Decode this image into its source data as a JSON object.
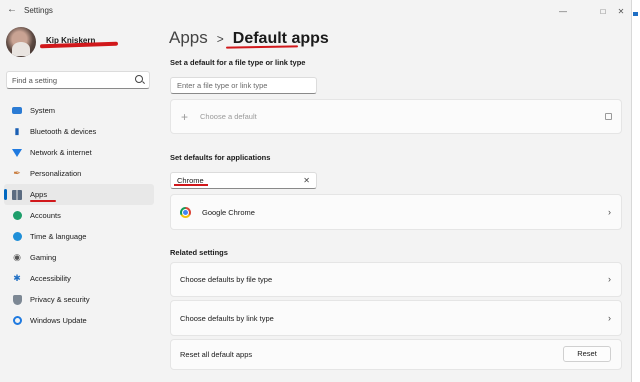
{
  "window": {
    "title": "Settings",
    "controls": [
      "minimize",
      "maximize",
      "close"
    ]
  },
  "profile": {
    "name": "Kip Kniskern"
  },
  "search": {
    "placeholder": "Find a setting"
  },
  "sidebar": {
    "items": [
      {
        "label": "System",
        "icon": "monitor-icon"
      },
      {
        "label": "Bluetooth & devices",
        "icon": "bluetooth-icon"
      },
      {
        "label": "Network & internet",
        "icon": "wifi-icon"
      },
      {
        "label": "Personalization",
        "icon": "brush-icon"
      },
      {
        "label": "Apps",
        "icon": "apps-icon",
        "active": true
      },
      {
        "label": "Accounts",
        "icon": "account-icon"
      },
      {
        "label": "Time & language",
        "icon": "globe-clock-icon"
      },
      {
        "label": "Gaming",
        "icon": "gamepad-icon"
      },
      {
        "label": "Accessibility",
        "icon": "accessibility-icon"
      },
      {
        "label": "Privacy & security",
        "icon": "shield-icon"
      },
      {
        "label": "Windows Update",
        "icon": "update-icon"
      }
    ]
  },
  "breadcrumb": {
    "parent": "Apps",
    "separator": ">",
    "current": "Default apps"
  },
  "file_type": {
    "heading": "Set a default for a file type or link type",
    "input_placeholder": "Enter a file type or link type",
    "choose_label": "Choose a default"
  },
  "apps_section": {
    "heading": "Set defaults for applications",
    "search_value": "Chrome",
    "result": "Google Chrome"
  },
  "related": {
    "heading": "Related settings",
    "items": [
      "Choose defaults by file type",
      "Choose defaults by link type"
    ],
    "reset_label": "Reset all default apps",
    "reset_button": "Reset"
  },
  "colors": {
    "accent": "#0067c0",
    "annotation": "#d1181b"
  }
}
